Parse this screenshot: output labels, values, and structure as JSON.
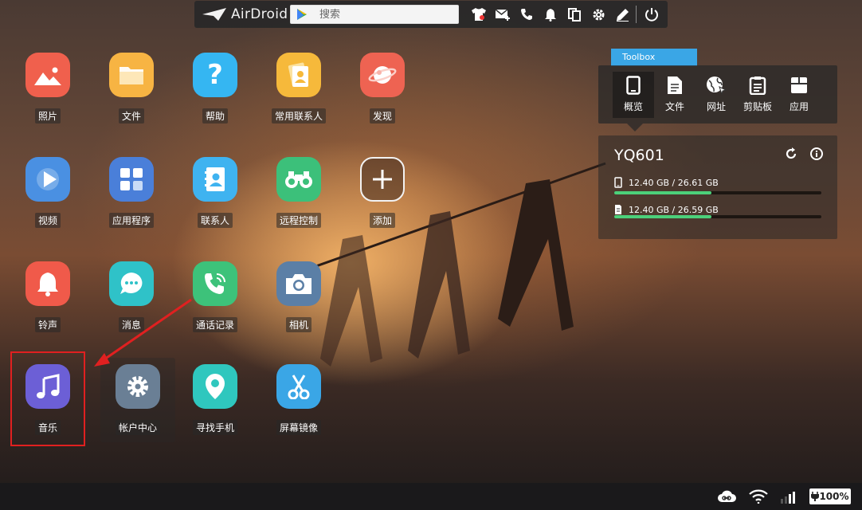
{
  "header": {
    "brand": "AirDroid",
    "search_placeholder": "搜索",
    "toolbar_icons": [
      "tshirt-icon",
      "mail-add-icon",
      "phone-icon",
      "bell-icon",
      "copy-icon",
      "gear-icon",
      "pen-icon",
      "power-icon"
    ]
  },
  "apps": [
    {
      "label": "照片",
      "icon": "photos-icon",
      "color": "#f0604d"
    },
    {
      "label": "文件",
      "icon": "folder-icon",
      "color": "#f7b443"
    },
    {
      "label": "帮助",
      "icon": "help-icon",
      "color": "#35b6f2"
    },
    {
      "label": "常用联系人",
      "icon": "favorite-contacts-icon",
      "color": "#f6b93b"
    },
    {
      "label": "发现",
      "icon": "discover-icon",
      "color": "#ee6352"
    },
    {
      "label": "视频",
      "icon": "video-icon",
      "color": "#4a90e2"
    },
    {
      "label": "应用程序",
      "icon": "apps-icon",
      "color": "#4a7fd9"
    },
    {
      "label": "联系人",
      "icon": "contacts-icon",
      "color": "#3fb3f0"
    },
    {
      "label": "远程控制",
      "icon": "binoculars-icon",
      "color": "#3cc07a"
    },
    {
      "label": "添加",
      "icon": "add-icon",
      "color": "transparent"
    },
    {
      "label": "铃声",
      "icon": "ringtone-icon",
      "color": "#f05a4a"
    },
    {
      "label": "消息",
      "icon": "message-icon",
      "color": "#2fc2c8"
    },
    {
      "label": "通话记录",
      "icon": "call-log-icon",
      "color": "#3dc27a"
    },
    {
      "label": "相机",
      "icon": "camera-icon",
      "color": "#5b7fa6"
    },
    {
      "label": "音乐",
      "icon": "music-icon",
      "color": "#6c5fd6"
    },
    {
      "label": "帐户中心",
      "icon": "account-gear-icon",
      "color": "#6a7f95"
    },
    {
      "label": "寻找手机",
      "icon": "find-phone-icon",
      "color": "#2fc7be"
    },
    {
      "label": "屏幕镜像",
      "icon": "scissors-icon",
      "color": "#3aa6e6"
    }
  ],
  "toolbox": {
    "tab_label": "Toolbox",
    "tools": [
      {
        "label": "概览",
        "icon": "phone-overview-icon"
      },
      {
        "label": "文件",
        "icon": "file-icon"
      },
      {
        "label": "网址",
        "icon": "globe-icon"
      },
      {
        "label": "剪贴板",
        "icon": "clipboard-icon"
      },
      {
        "label": "应用",
        "icon": "app-box-icon"
      }
    ]
  },
  "device": {
    "name": "YQ601",
    "internal_storage": {
      "text": "12.40 GB / 26.61 GB",
      "used_fraction": 0.47
    },
    "sd_storage": {
      "text": "12.40 GB / 26.59 GB",
      "used_fraction": 0.47
    }
  },
  "status": {
    "battery": "100%",
    "icons": [
      "cloud-link-icon",
      "wifi-icon",
      "signal-icon",
      "battery-icon"
    ]
  }
}
